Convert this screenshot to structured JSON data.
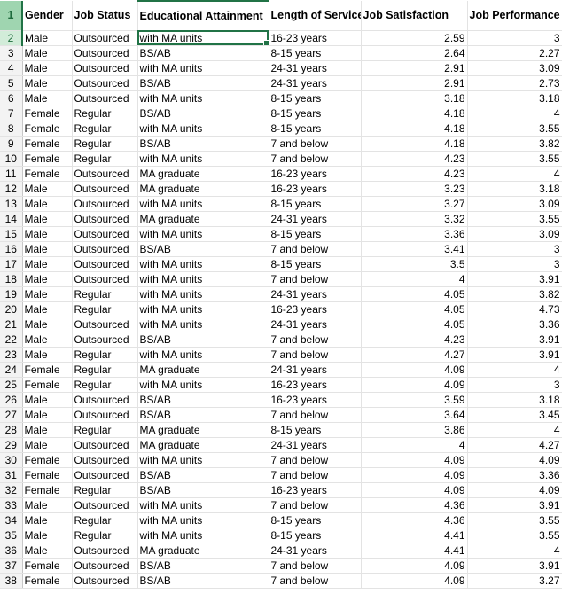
{
  "headers": [
    "Gender",
    "Job Status",
    "Educational Attainment",
    "Length of Service",
    "Job Satisfaction",
    "Job Performance"
  ],
  "header_row_number": "1",
  "accent_color": "#217346",
  "rows": [
    {
      "n": "2",
      "c": [
        "Male",
        "Outsourced",
        "with MA units",
        "16-23 years",
        "2.59",
        "3"
      ]
    },
    {
      "n": "3",
      "c": [
        "Male",
        "Outsourced",
        "BS/AB",
        "8-15 years",
        "2.64",
        "2.27"
      ]
    },
    {
      "n": "4",
      "c": [
        "Male",
        "Outsourced",
        "with MA units",
        "24-31 years",
        "2.91",
        "3.09"
      ]
    },
    {
      "n": "5",
      "c": [
        "Male",
        "Outsourced",
        "BS/AB",
        "24-31 years",
        "2.91",
        "2.73"
      ]
    },
    {
      "n": "6",
      "c": [
        "Male",
        "Outsourced",
        "with MA units",
        "8-15 years",
        "3.18",
        "3.18"
      ]
    },
    {
      "n": "7",
      "c": [
        "Female",
        "Regular",
        "BS/AB",
        "8-15 years",
        "4.18",
        "4"
      ]
    },
    {
      "n": "8",
      "c": [
        "Female",
        "Regular",
        "with MA units",
        "8-15 years",
        "4.18",
        "3.55"
      ]
    },
    {
      "n": "9",
      "c": [
        "Female",
        "Regular",
        "BS/AB",
        "7 and below",
        "4.18",
        "3.82"
      ]
    },
    {
      "n": "10",
      "c": [
        "Female",
        "Regular",
        "with MA units",
        "7 and below",
        "4.23",
        "3.55"
      ]
    },
    {
      "n": "11",
      "c": [
        "Female",
        "Outsourced",
        "MA graduate",
        "16-23 years",
        "4.23",
        "4"
      ]
    },
    {
      "n": "12",
      "c": [
        "Male",
        "Outsourced",
        "MA graduate",
        "16-23 years",
        "3.23",
        "3.18"
      ]
    },
    {
      "n": "13",
      "c": [
        "Male",
        "Outsourced",
        "with MA units",
        "8-15 years",
        "3.27",
        "3.09"
      ]
    },
    {
      "n": "14",
      "c": [
        "Male",
        "Outsourced",
        "MA graduate",
        "24-31 years",
        "3.32",
        "3.55"
      ]
    },
    {
      "n": "15",
      "c": [
        "Male",
        "Outsourced",
        "with MA units",
        "8-15 years",
        "3.36",
        "3.09"
      ]
    },
    {
      "n": "16",
      "c": [
        "Male",
        "Outsourced",
        "BS/AB",
        "7 and below",
        "3.41",
        "3"
      ]
    },
    {
      "n": "17",
      "c": [
        "Male",
        "Outsourced",
        "with MA units",
        "8-15 years",
        "3.5",
        "3"
      ]
    },
    {
      "n": "18",
      "c": [
        "Male",
        "Outsourced",
        "with MA units",
        "7 and below",
        "4",
        "3.91"
      ]
    },
    {
      "n": "19",
      "c": [
        "Male",
        "Regular",
        "with MA units",
        "24-31 years",
        "4.05",
        "3.82"
      ]
    },
    {
      "n": "20",
      "c": [
        "Male",
        "Regular",
        "with MA units",
        "16-23 years",
        "4.05",
        "4.73"
      ]
    },
    {
      "n": "21",
      "c": [
        "Male",
        "Outsourced",
        "with MA units",
        "24-31 years",
        "4.05",
        "3.36"
      ]
    },
    {
      "n": "22",
      "c": [
        "Male",
        "Outsourced",
        "BS/AB",
        "7 and below",
        "4.23",
        "3.91"
      ]
    },
    {
      "n": "23",
      "c": [
        "Male",
        "Regular",
        "with MA units",
        "7 and below",
        "4.27",
        "3.91"
      ]
    },
    {
      "n": "24",
      "c": [
        "Female",
        "Regular",
        "MA graduate",
        "24-31 years",
        "4.09",
        "4"
      ]
    },
    {
      "n": "25",
      "c": [
        "Female",
        "Regular",
        "with MA units",
        "16-23 years",
        "4.09",
        "3"
      ]
    },
    {
      "n": "26",
      "c": [
        "Male",
        "Outsourced",
        "BS/AB",
        "16-23 years",
        "3.59",
        "3.18"
      ]
    },
    {
      "n": "27",
      "c": [
        "Male",
        "Outsourced",
        "BS/AB",
        "7 and below",
        "3.64",
        "3.45"
      ]
    },
    {
      "n": "28",
      "c": [
        "Male",
        "Regular",
        "MA graduate",
        "8-15 years",
        "3.86",
        "4"
      ]
    },
    {
      "n": "29",
      "c": [
        "Male",
        "Outsourced",
        "MA graduate",
        "24-31 years",
        "4",
        "4.27"
      ]
    },
    {
      "n": "30",
      "c": [
        "Female",
        "Outsourced",
        "with MA units",
        "7 and below",
        "4.09",
        "4.09"
      ]
    },
    {
      "n": "31",
      "c": [
        "Female",
        "Outsourced",
        "BS/AB",
        "7 and below",
        "4.09",
        "3.36"
      ]
    },
    {
      "n": "32",
      "c": [
        "Female",
        "Regular",
        "BS/AB",
        "16-23 years",
        "4.09",
        "4.09"
      ]
    },
    {
      "n": "33",
      "c": [
        "Male",
        "Outsourced",
        "with MA units",
        "7 and below",
        "4.36",
        "3.91"
      ]
    },
    {
      "n": "34",
      "c": [
        "Male",
        "Regular",
        "with MA units",
        "8-15 years",
        "4.36",
        "3.55"
      ]
    },
    {
      "n": "35",
      "c": [
        "Male",
        "Regular",
        "with MA units",
        "8-15 years",
        "4.41",
        "3.55"
      ]
    },
    {
      "n": "36",
      "c": [
        "Male",
        "Outsourced",
        "MA graduate",
        "24-31 years",
        "4.41",
        "4"
      ]
    },
    {
      "n": "37",
      "c": [
        "Female",
        "Outsourced",
        "BS/AB",
        "7 and below",
        "4.09",
        "3.91"
      ]
    },
    {
      "n": "38",
      "c": [
        "Female",
        "Outsourced",
        "BS/AB",
        "7 and below",
        "4.09",
        "3.27"
      ]
    }
  ]
}
